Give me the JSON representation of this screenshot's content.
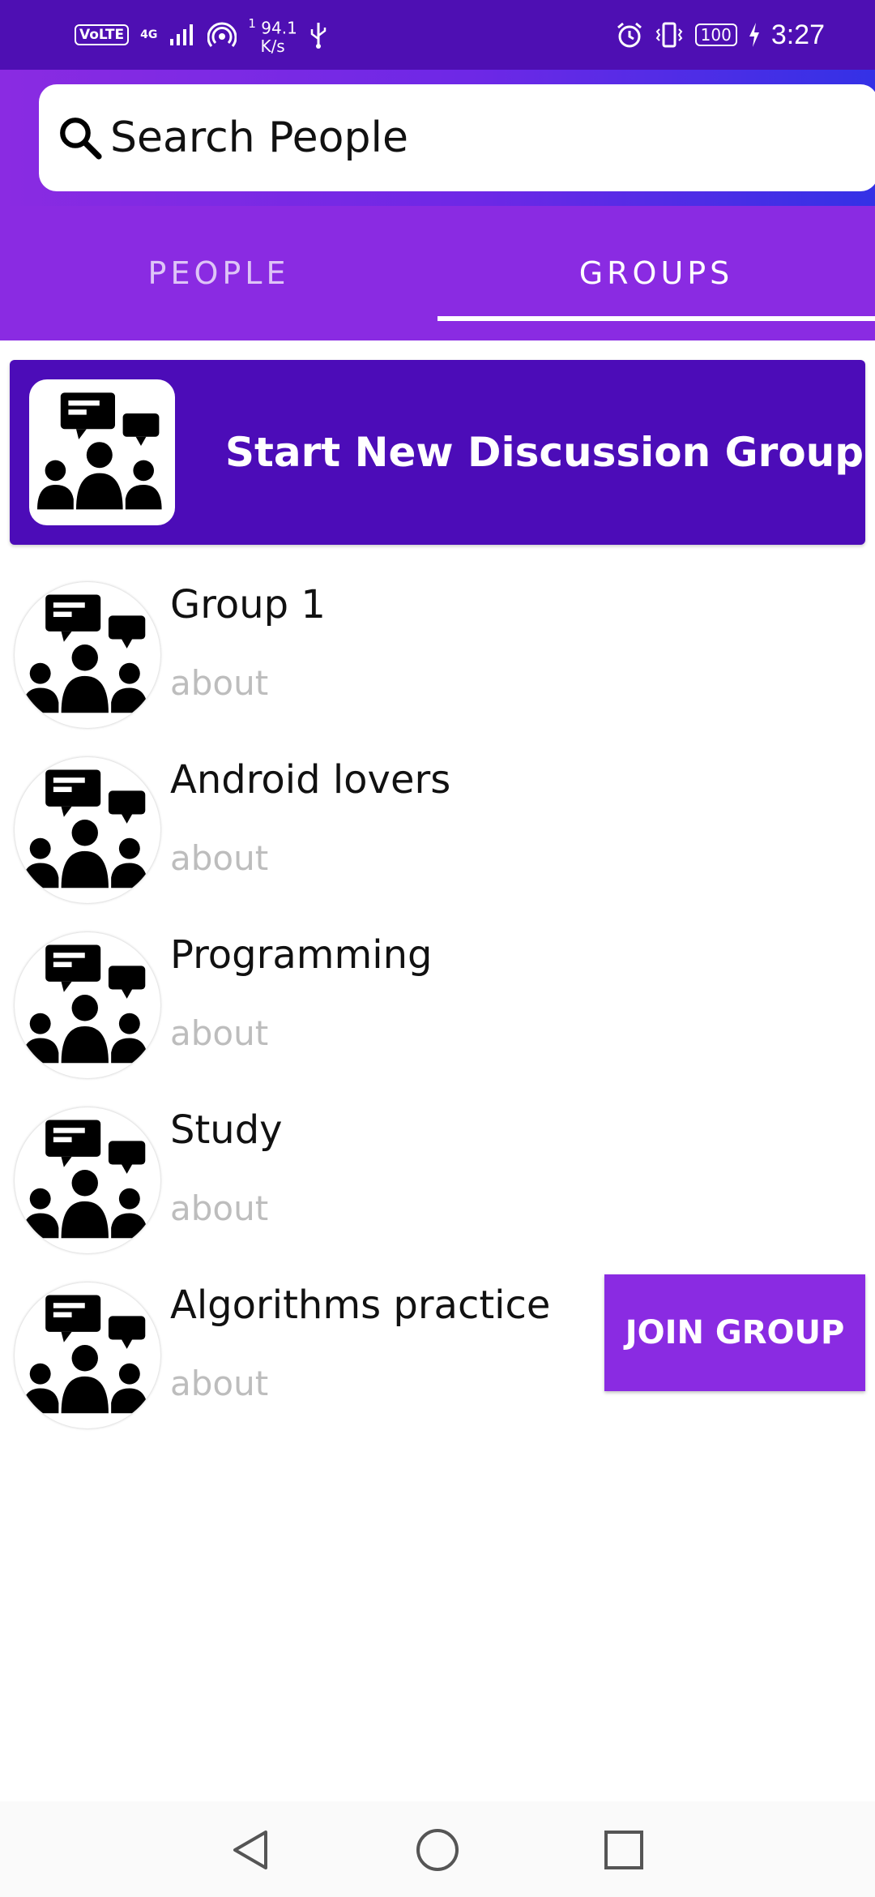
{
  "status_bar": {
    "volte": "VoLTE",
    "network": "4G",
    "speed_value": "94.1",
    "speed_unit": "K/s",
    "speed_prefix": "1",
    "battery": "100",
    "time": "3:27"
  },
  "search": {
    "placeholder": "Search People",
    "icon": "search-icon"
  },
  "tabs": [
    {
      "label": "PEOPLE",
      "active": false
    },
    {
      "label": "GROUPS",
      "active": true
    }
  ],
  "new_group": {
    "label": "Start New Discussion Group",
    "icon": "discussion-group-icon"
  },
  "groups": [
    {
      "name": "Group 1",
      "about": "about"
    },
    {
      "name": "Android lovers",
      "about": "about"
    },
    {
      "name": "Programming",
      "about": "about"
    },
    {
      "name": "Study",
      "about": "about"
    },
    {
      "name": "Algorithms practice",
      "about": "about"
    }
  ],
  "join_button": {
    "label": "JOIN GROUP"
  },
  "nav": {
    "back": "back-icon",
    "home": "home-icon",
    "recents": "recents-icon"
  },
  "colors": {
    "status_bar": "#4e0fb3",
    "primary": "#8a2be2",
    "banner": "#4c0cb8",
    "about_text": "#bdbdbd"
  }
}
